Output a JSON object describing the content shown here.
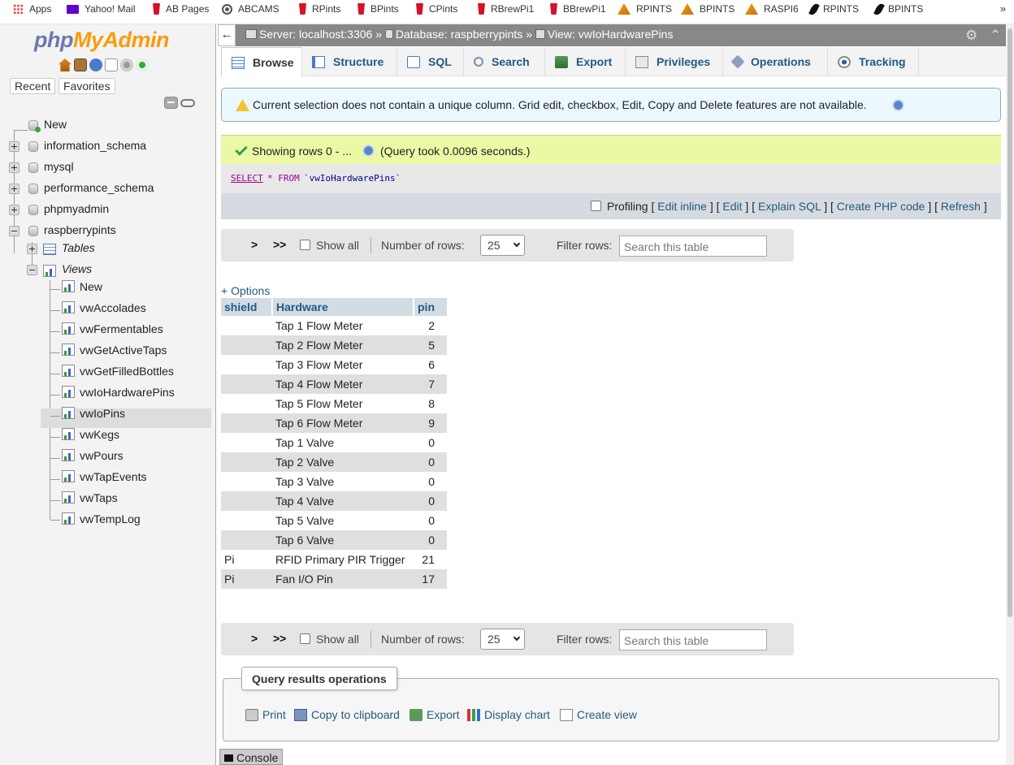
{
  "bookmarks": [
    {
      "label": "Apps",
      "icon": "apps-grid-icon"
    },
    {
      "label": "Yahoo! Mail",
      "icon": "yahoo-mail-icon"
    },
    {
      "label": "AB Pages",
      "icon": "cup-icon"
    },
    {
      "label": "ABCAMS",
      "icon": "globe-icon"
    },
    {
      "label": "RPints",
      "icon": "cup-icon"
    },
    {
      "label": "BPints",
      "icon": "cup-icon"
    },
    {
      "label": "CPints",
      "icon": "cup-icon"
    },
    {
      "label": "RBrewPi1",
      "icon": "cup-icon"
    },
    {
      "label": "BBrewPi1",
      "icon": "cup-icon"
    },
    {
      "label": "RPINTS",
      "icon": "pma-icon"
    },
    {
      "label": "BPINTS",
      "icon": "pma-icon"
    },
    {
      "label": "RASPI6",
      "icon": "pma-icon"
    },
    {
      "label": "RPINTS",
      "icon": "quill-icon"
    },
    {
      "label": "BPINTS",
      "icon": "quill-icon"
    }
  ],
  "bookmarks_more": "»",
  "nav": {
    "logo_php": "php",
    "logo_myadmin": "MyAdmin",
    "tab_recent": "Recent",
    "tab_favorites": "Favorites",
    "tree": {
      "new": "New",
      "databases": [
        "information_schema",
        "mysql",
        "performance_schema",
        "phpmyadmin",
        "raspberrypints"
      ],
      "tables": "Tables",
      "views": "Views",
      "view_new": "New",
      "view_items": [
        "vwAccolades",
        "vwFermentables",
        "vwGetActiveTaps",
        "vwGetFilledBottles",
        "vwIoHardwarePins",
        "vwIoPins",
        "vwKegs",
        "vwPours",
        "vwTapEvents",
        "vwTaps",
        "vwTempLog"
      ],
      "selected_view": "vwIoHardwarePins"
    }
  },
  "topbar": {
    "back": "←",
    "server": "Server: localhost:3306",
    "sep1": "»",
    "database": "Database: raspberrypints",
    "sep2": "»",
    "view": "View: vwIoHardwarePins",
    "settings": "⚙",
    "collapse": "⌃"
  },
  "tabs": [
    {
      "label": "Browse",
      "icon": "browse",
      "active": true
    },
    {
      "label": "Structure",
      "icon": "structure"
    },
    {
      "label": "SQL",
      "icon": "sql"
    },
    {
      "label": "Search",
      "icon": "search"
    },
    {
      "label": "Export",
      "icon": "export"
    },
    {
      "label": "Privileges",
      "icon": "priv"
    },
    {
      "label": "Operations",
      "icon": "ops"
    },
    {
      "label": "Tracking",
      "icon": "track"
    }
  ],
  "notice": "Current selection does not contain a unique column. Grid edit, checkbox, Edit, Copy and Delete features are not available.",
  "success": {
    "text": "Showing rows 0 - ...",
    "query_time": "(Query took 0.0096 seconds.)"
  },
  "sql": {
    "keyword": "SELECT",
    "rest": "* FROM",
    "table": "`vwIoHardwarePins`"
  },
  "profiling": {
    "label": "Profiling",
    "links": [
      "Edit inline",
      "Edit",
      "Explain SQL",
      "Create PHP code",
      "Refresh"
    ]
  },
  "pager": {
    "next": ">",
    "last": ">>",
    "show_all": "Show all",
    "rows_label": "Number of rows:",
    "rows_value": "25",
    "filter_label": "Filter rows:",
    "filter_placeholder": "Search this table"
  },
  "options_link": "+ Options",
  "table": {
    "columns": [
      "shield",
      "Hardware",
      "pin"
    ],
    "rows": [
      [
        "",
        "Tap 1 Flow Meter",
        "2"
      ],
      [
        "",
        "Tap 2 Flow Meter",
        "5"
      ],
      [
        "",
        "Tap 3 Flow Meter",
        "6"
      ],
      [
        "",
        "Tap 4 Flow Meter",
        "7"
      ],
      [
        "",
        "Tap 5 Flow Meter",
        "8"
      ],
      [
        "",
        "Tap 6 Flow Meter",
        "9"
      ],
      [
        "",
        "Tap 1 Valve",
        "0"
      ],
      [
        "",
        "Tap 2 Valve",
        "0"
      ],
      [
        "",
        "Tap 3 Valve",
        "0"
      ],
      [
        "",
        "Tap 4 Valve",
        "0"
      ],
      [
        "",
        "Tap 5 Valve",
        "0"
      ],
      [
        "",
        "Tap 6 Valve",
        "0"
      ],
      [
        "Pi",
        "RFID Primary PIR Trigger",
        "21"
      ],
      [
        "Pi",
        "Fan I/O Pin",
        "17"
      ]
    ]
  },
  "query_ops": {
    "legend": "Query results operations",
    "items": [
      {
        "label": "Print",
        "icon": "print"
      },
      {
        "label": "Copy to clipboard",
        "icon": "copy"
      },
      {
        "label": "Export",
        "icon": "export"
      },
      {
        "label": "Display chart",
        "icon": "chart"
      },
      {
        "label": "Create view",
        "icon": "view"
      }
    ]
  },
  "console": "Console"
}
